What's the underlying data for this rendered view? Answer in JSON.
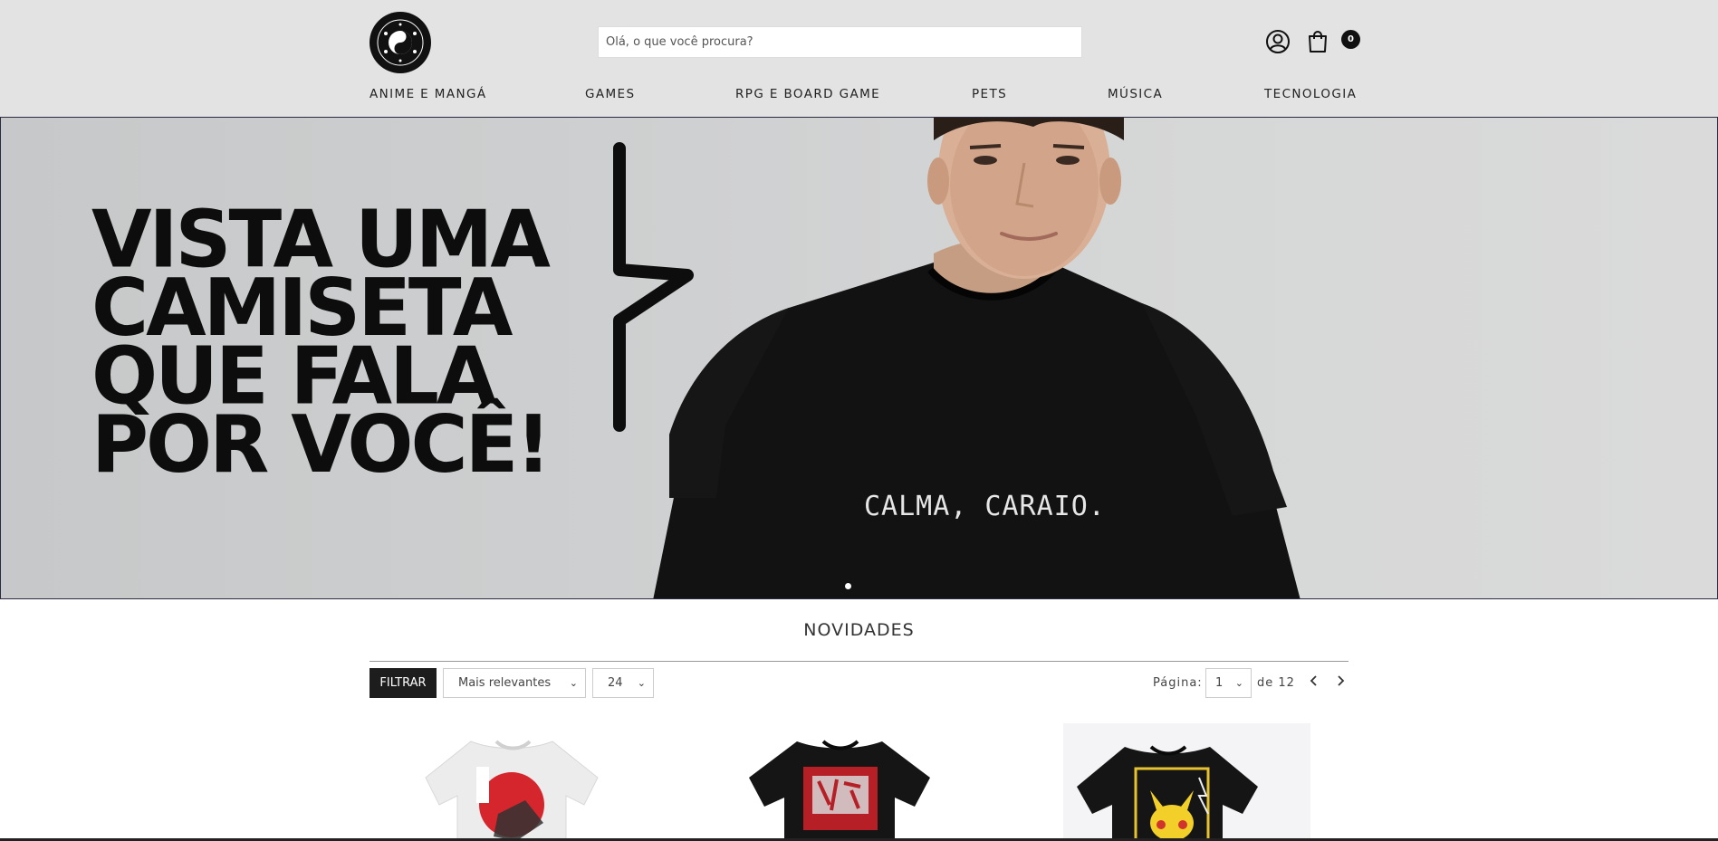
{
  "header": {
    "search_placeholder": "Olá, o que você procura?",
    "cart_count": "0",
    "nav": [
      {
        "label": "ANIME E MANGÁ"
      },
      {
        "label": "GAMES"
      },
      {
        "label": "RPG E BOARD GAME"
      },
      {
        "label": "PETS"
      },
      {
        "label": "MÚSICA"
      },
      {
        "label": "TECNOLOGIA"
      }
    ]
  },
  "hero": {
    "headline_lines": [
      "VISTA UMA",
      "CAMISETA",
      "QUE FALA",
      "POR VOCÊ!"
    ],
    "shirt_text": "CALMA, CARAIO."
  },
  "section": {
    "title": "NOVIDADES",
    "filter_label": "FILTRAR",
    "sort_selected": "Mais relevantes",
    "per_page_selected": "24",
    "page_label": "Página:",
    "page_selected": "1",
    "page_of": "de 12"
  },
  "colors": {
    "header_bg": "#e3e3e3",
    "dark": "#1d1d1d",
    "hero_bg": "#cfd0d1"
  }
}
